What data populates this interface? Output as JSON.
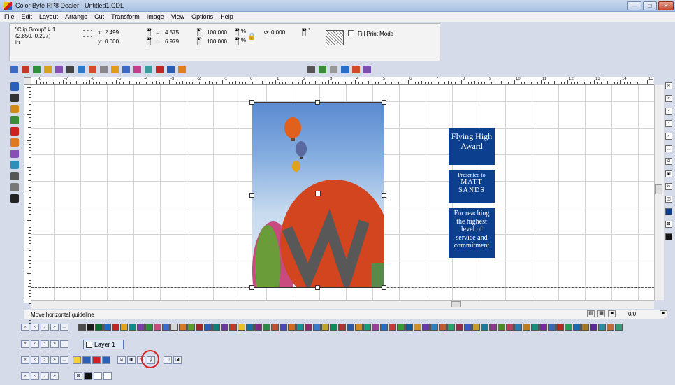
{
  "window": {
    "title": "Color Byte RP8 Dealer - Untitled1.CDL",
    "min": "—",
    "max": "□",
    "close": "✕"
  },
  "menu": [
    "File",
    "Edit",
    "Layout",
    "Arrange",
    "Cut",
    "Transform",
    "Image",
    "View",
    "Options",
    "Help"
  ],
  "properties": {
    "object_name": "\"Clip Group\" # 1",
    "object_pos": "(2.850,-0.297)",
    "unit": "in",
    "x_label": "x:",
    "x_value": "2.499",
    "y_label": "y:",
    "y_value": "0.000",
    "w_value": "4.575",
    "h_value": "6.979",
    "sx_value": "100.000",
    "sy_value": "100.000",
    "pct1": "%",
    "pct2": "%",
    "angle": "0.000",
    "deg": "°",
    "fill_label": "Fill Print Mode"
  },
  "ruler": {
    "numbers": [
      "-8",
      "-7",
      "-6",
      "-5",
      "-4",
      "-3",
      "-2",
      "-1",
      "0",
      "1",
      "2",
      "3",
      "4",
      "5",
      "6",
      "7",
      "8",
      "9",
      "10",
      "11",
      "12",
      "13",
      "14",
      "15"
    ]
  },
  "award": {
    "title_line1": "Flying High",
    "title_line2": "Award",
    "presented": "Presented to",
    "name_line1": "MATT",
    "name_line2": "SANDS",
    "reason": [
      "For reaching",
      "the highest",
      "level of",
      "service and",
      "commitment"
    ]
  },
  "status": {
    "text": "Move horizontal guideline",
    "page": "0/0",
    "left_arrow": "◄",
    "right_arrow": "►"
  },
  "layer": {
    "name": "Layer 1"
  },
  "colors": {
    "accent": "#0d3f8f",
    "circle": "#d52222"
  }
}
